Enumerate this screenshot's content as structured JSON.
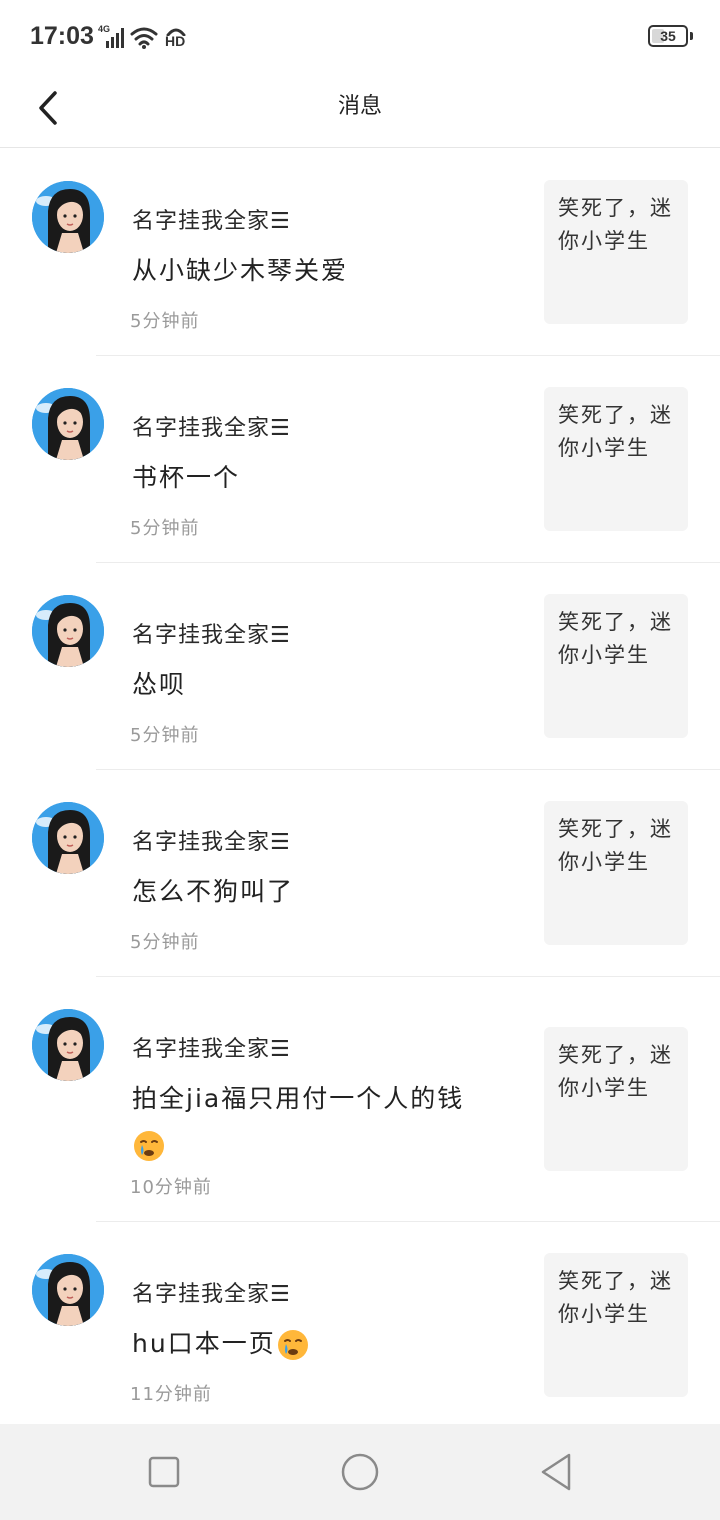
{
  "status_bar": {
    "time": "17:03",
    "network": "4G",
    "hd": "HD",
    "battery": "35",
    "battery_level": 0.35
  },
  "header": {
    "title": "消息",
    "back_icon": "chevron-left-icon"
  },
  "messages": [
    {
      "user": "名字挂我全家☰",
      "comment": "从小缺少木琴关爱",
      "emoji": "",
      "time": "5分钟前",
      "quote": "笑死了，迷你小学生"
    },
    {
      "user": "名字挂我全家☰",
      "comment": "书杯一个",
      "emoji": "",
      "time": "5分钟前",
      "quote": "笑死了，迷你小学生"
    },
    {
      "user": "名字挂我全家☰",
      "comment": "怂呗",
      "emoji": "",
      "time": "5分钟前",
      "quote": "笑死了，迷你小学生"
    },
    {
      "user": "名字挂我全家☰",
      "comment": "怎么不狗叫了",
      "emoji": "",
      "time": "5分钟前",
      "quote": "笑死了，迷你小学生"
    },
    {
      "user": "名字挂我全家☰",
      "comment": "拍全jia福只用付一个人的钱",
      "emoji": "crying-face-emoji",
      "time": "10分钟前",
      "quote": "笑死了，迷你小学生"
    },
    {
      "user": "名字挂我全家☰",
      "comment": "hu口本一页",
      "emoji": "crying-face-emoji",
      "time": "11分钟前",
      "quote": "笑死了，迷你小学生"
    }
  ],
  "system_nav": {
    "recent": "square-icon",
    "home": "circle-icon",
    "back": "triangle-back-icon"
  },
  "colors": {
    "avatar_bg": "#3aa0e8",
    "quote_bg": "#f4f4f4",
    "time_text": "#9a9a9a",
    "nav_bg": "#f2f2f2"
  }
}
